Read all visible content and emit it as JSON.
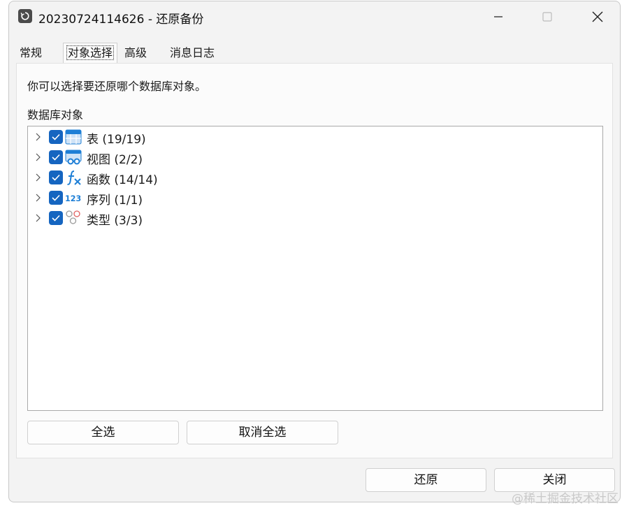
{
  "window": {
    "title": "20230724114626 - 还原备份",
    "icon": "restore-icon",
    "controls": [
      "minimize-icon",
      "maximize-icon",
      "close-icon"
    ]
  },
  "tabs": [
    {
      "label": "常规",
      "active": false
    },
    {
      "label": "对象选择",
      "active": true
    },
    {
      "label": "高级",
      "active": false
    },
    {
      "label": "消息日志",
      "active": false
    }
  ],
  "panel": {
    "description": "你可以选择要还原哪个数据库对象。",
    "group_label": "数据库对象"
  },
  "tree": {
    "items": [
      {
        "label": "表 (19/19)",
        "icon": "table-icon",
        "checked": true
      },
      {
        "label": "视图 (2/2)",
        "icon": "view-icon",
        "checked": true
      },
      {
        "label": "函数 (14/14)",
        "icon": "function-icon",
        "checked": true
      },
      {
        "label": "序列 (1/1)",
        "icon": "sequence-icon",
        "checked": true
      },
      {
        "label": "类型 (3/3)",
        "icon": "type-icon",
        "checked": true
      }
    ]
  },
  "buttons": {
    "select_all": "全选",
    "deselect_all": "取消全选",
    "restore": "还原",
    "close": "关闭"
  },
  "icon_text": {
    "sequence": "123"
  },
  "watermark": "@稀土掘金技术社区",
  "colors": {
    "checkbox": "#1565c0",
    "icon_blue": "#1e7fd6"
  }
}
